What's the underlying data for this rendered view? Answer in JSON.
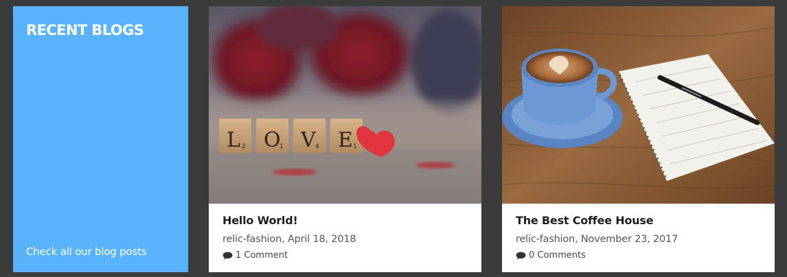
{
  "promo": {
    "title": "RECENT BLOGS",
    "link_label": "Check all our blog posts",
    "background": "#58b3fc"
  },
  "posts": [
    {
      "title": "Hello World!",
      "author": "relic-fashion",
      "date": "April 18, 2018",
      "comments": "1 Comment",
      "image_subject": "love-letter-tiles-with-heart-and-roses",
      "tile_letters": [
        "L",
        "O",
        "V",
        "E"
      ],
      "tile_points": [
        "2",
        "1",
        "4",
        "1"
      ]
    },
    {
      "title": "The Best Coffee House",
      "author": "relic-fashion",
      "date": "November 23, 2017",
      "comments": "0 Comments",
      "image_subject": "coffee-cup-notebook-pen-on-wooden-table"
    }
  ],
  "colors": {
    "page_background": "#3b3b3b",
    "card_background": "#ffffff",
    "title_text": "#1e1e1e",
    "meta_text": "#555555"
  }
}
